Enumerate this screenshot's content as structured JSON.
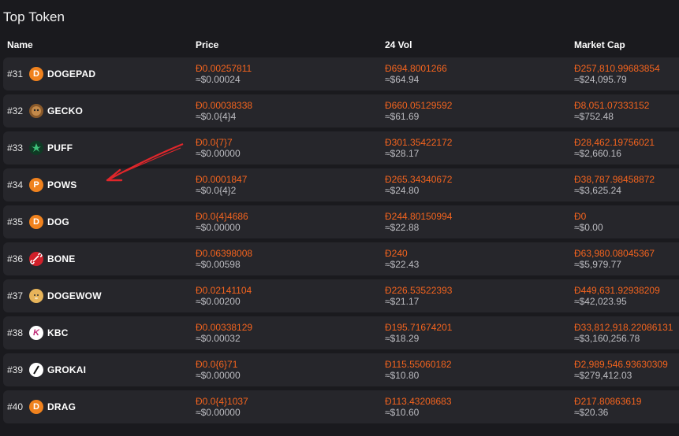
{
  "title": "Top Token",
  "columns": {
    "name": "Name",
    "price": "Price",
    "vol": "24 Vol",
    "cap": "Market Cap"
  },
  "rows": [
    {
      "rank": "#31",
      "symbol": "DOGEPAD",
      "icon": "doge-coin-icon",
      "icon_letter": "D",
      "icon_color": "#f0821e",
      "price": "Đ0.00257811",
      "price_usd": "≈$0.00024",
      "vol": "Đ694.8001266",
      "vol_usd": "≈$64.94",
      "cap": "Đ257,810.99683854",
      "cap_usd": "≈$24,095.79"
    },
    {
      "rank": "#32",
      "symbol": "GECKO",
      "icon": "gecko-icon",
      "icon_letter": "",
      "icon_color": "#8a5a2b",
      "price": "Đ0.00038338",
      "price_usd": "≈$0.0{4}4",
      "vol": "Đ660.05129592",
      "vol_usd": "≈$61.69",
      "cap": "Đ8,051.07333152",
      "cap_usd": "≈$752.48"
    },
    {
      "rank": "#33",
      "symbol": "PUFF",
      "icon": "leaf-icon",
      "icon_letter": "",
      "icon_color": "#0f3a24",
      "price": "Đ0.0{7}7",
      "price_usd": "≈$0.00000",
      "vol": "Đ301.35422172",
      "vol_usd": "≈$28.17",
      "cap": "Đ28,462.19756021",
      "cap_usd": "≈$2,660.16"
    },
    {
      "rank": "#34",
      "symbol": "POWS",
      "icon": "pows-coin-icon",
      "icon_letter": "P",
      "icon_color": "#f0821e",
      "price": "Đ0.0001847",
      "price_usd": "≈$0.0{4}2",
      "vol": "Đ265.34340672",
      "vol_usd": "≈$24.80",
      "cap": "Đ38,787.98458872",
      "cap_usd": "≈$3,625.24"
    },
    {
      "rank": "#35",
      "symbol": "DOG",
      "icon": "doge-coin-icon",
      "icon_letter": "D",
      "icon_color": "#f0821e",
      "price": "Đ0.0{4}4686",
      "price_usd": "≈$0.00000",
      "vol": "Đ244.80150994",
      "vol_usd": "≈$22.88",
      "cap": "Đ0",
      "cap_usd": "≈$0.00"
    },
    {
      "rank": "#36",
      "symbol": "BONE",
      "icon": "bone-icon",
      "icon_letter": "",
      "icon_color": "#d0202a",
      "price": "Đ0.06398008",
      "price_usd": "≈$0.00598",
      "vol": "Đ240",
      "vol_usd": "≈$22.43",
      "cap": "Đ63,980.08045367",
      "cap_usd": "≈$5,979.77"
    },
    {
      "rank": "#37",
      "symbol": "DOGEWOW",
      "icon": "doge-face-icon",
      "icon_letter": "",
      "icon_color": "#e7b45a",
      "price": "Đ0.02141104",
      "price_usd": "≈$0.00200",
      "vol": "Đ226.53522393",
      "vol_usd": "≈$21.17",
      "cap": "Đ449,631.92938209",
      "cap_usd": "≈$42,023.95"
    },
    {
      "rank": "#38",
      "symbol": "KBC",
      "icon": "kbc-icon",
      "icon_letter": "K",
      "icon_color": "#ffffff",
      "price": "Đ0.00338129",
      "price_usd": "≈$0.00032",
      "vol": "Đ195.71674201",
      "vol_usd": "≈$18.29",
      "cap": "Đ33,812,918.22086131",
      "cap_usd": "≈$3,160,256.78"
    },
    {
      "rank": "#39",
      "symbol": "GROKAI",
      "icon": "slash-icon",
      "icon_letter": "",
      "icon_color": "#ffffff",
      "price": "Đ0.0{6}71",
      "price_usd": "≈$0.00000",
      "vol": "Đ115.55060182",
      "vol_usd": "≈$10.80",
      "cap": "Đ2,989,546.93630309",
      "cap_usd": "≈$279,412.03"
    },
    {
      "rank": "#40",
      "symbol": "DRAG",
      "icon": "doge-coin-icon",
      "icon_letter": "D",
      "icon_color": "#f0821e",
      "price": "Đ0.0{4}1037",
      "price_usd": "≈$0.00000",
      "vol": "Đ113.43208683",
      "vol_usd": "≈$10.60",
      "cap": "Đ217.80863619",
      "cap_usd": "≈$20.36"
    }
  ],
  "annotation": {
    "icon": "red-arrow-annotation-icon",
    "color": "#e0262b"
  }
}
